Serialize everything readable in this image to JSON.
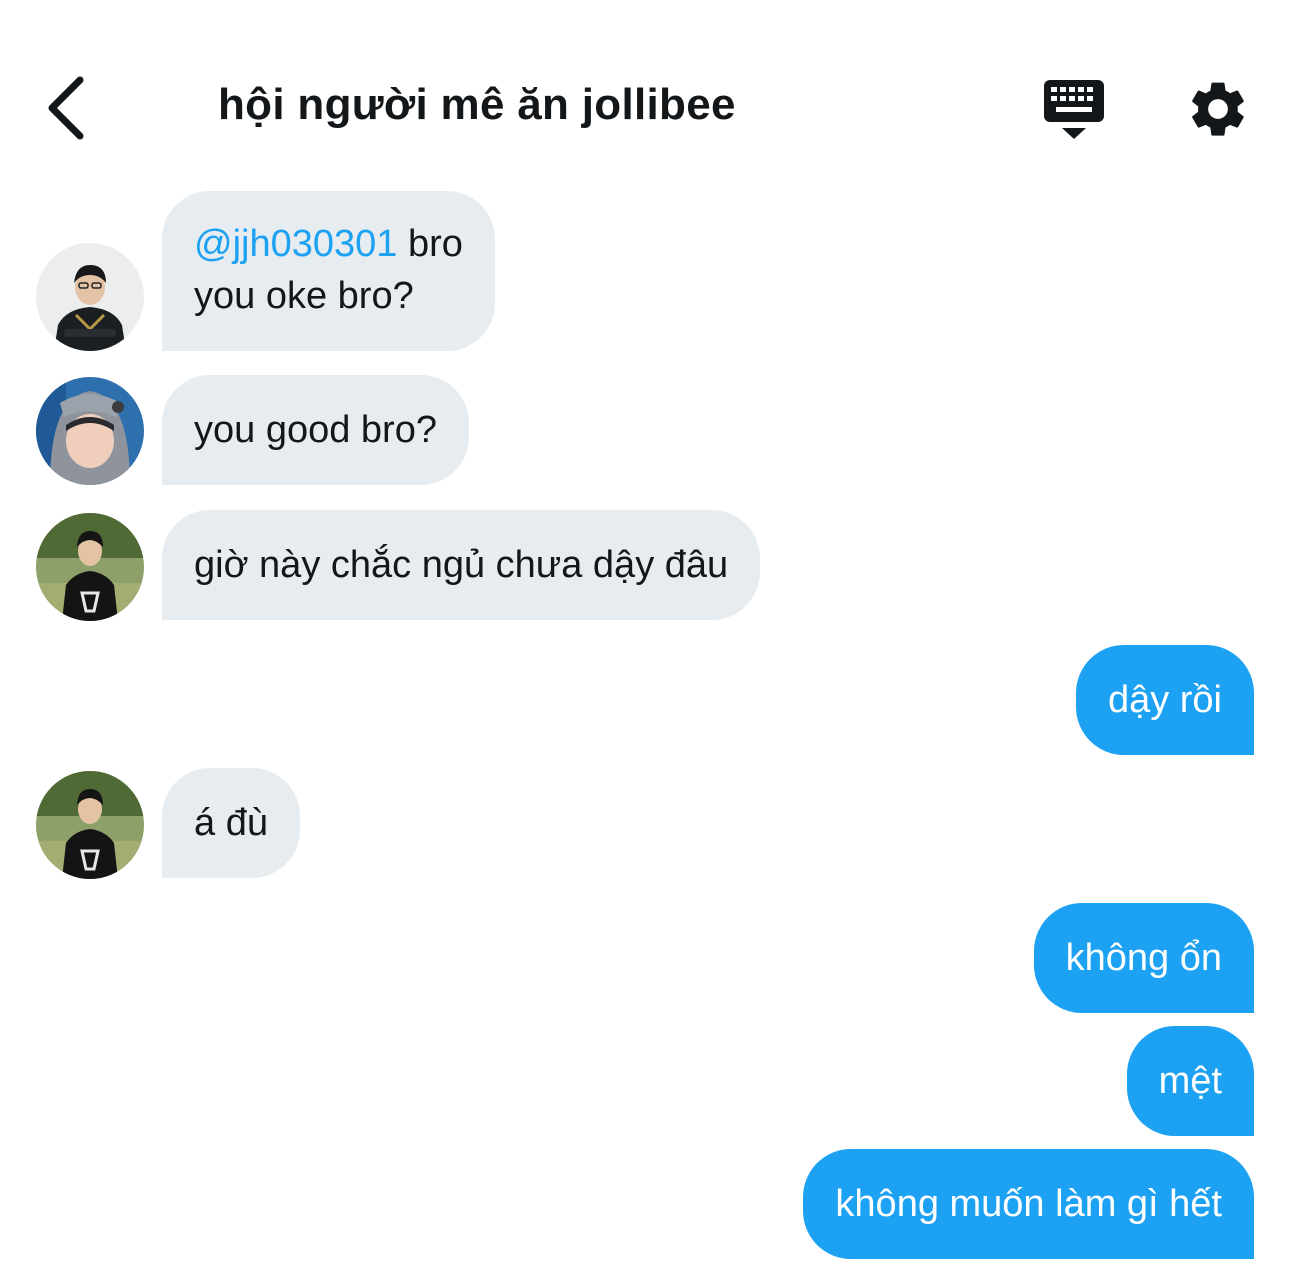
{
  "header": {
    "title": "hội người mê ăn jollibee",
    "back_icon": "chevron-left-icon",
    "keyboard_icon": "keyboard-icon",
    "settings_icon": "gear-icon"
  },
  "colors": {
    "incoming_bubble": "#e6ecf0",
    "outgoing_bubble": "#1da1f2",
    "mention": "#1da1f2",
    "text": "#14171a"
  },
  "messages": [
    {
      "direction": "incoming",
      "mention": "@jjh030301",
      "text_after_mention": " bro",
      "line2": "you oke bro?"
    },
    {
      "direction": "incoming",
      "text": "you good bro?"
    },
    {
      "direction": "incoming",
      "text": "giờ này chắc ngủ chưa dậy đâu"
    },
    {
      "direction": "outgoing",
      "text": "dậy rồi"
    },
    {
      "direction": "incoming",
      "text": "á đù"
    },
    {
      "direction": "outgoing",
      "text": "không ổn"
    },
    {
      "direction": "outgoing",
      "text": "mệt"
    },
    {
      "direction": "outgoing",
      "text": "không muốn làm gì hết"
    }
  ]
}
